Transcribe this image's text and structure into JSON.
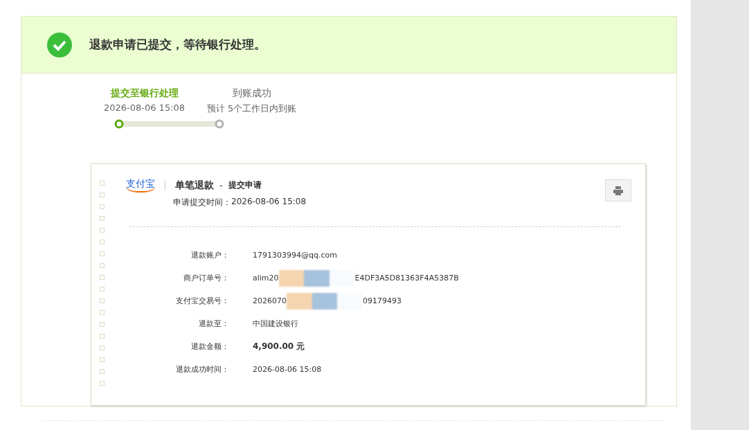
{
  "banner": {
    "message": "退款申请已提交，等待银行处理。"
  },
  "steps": [
    {
      "title": "提交至银行处理",
      "subtitle": "2026-08-06 15:08",
      "selected": true
    },
    {
      "title": "到账成功",
      "subtitle": "预计 5个工作日内到账",
      "selected": false
    }
  ],
  "receipt": {
    "logo": "支付宝",
    "title": "单笔退款",
    "separator": "-",
    "subtitle": "提交申请",
    "time_label": "申请提交时间：",
    "time": "2026-08-06 15:08",
    "fields": [
      {
        "label": "退款账户：",
        "value": "1791303994@qq.com",
        "redacted": false,
        "bold": false
      },
      {
        "label": "商户订单号：",
        "value": "alim20",
        "value_end": "E4DF3A5D81363F4A5387B",
        "redacted": true,
        "bold": false
      },
      {
        "label": "支付宝交易号：",
        "value": "2026070",
        "value_end": "09179493",
        "redacted": true,
        "bold": false
      },
      {
        "label": "退款至：",
        "value": "中国建设银行",
        "redacted": false,
        "bold": false
      },
      {
        "label": "退款金额：",
        "value": "4,900.00 元",
        "redacted": false,
        "bold": true
      },
      {
        "label": "退款成功时间：",
        "value": "2026-08-06 15:08",
        "redacted": false,
        "bold": false
      }
    ]
  }
}
